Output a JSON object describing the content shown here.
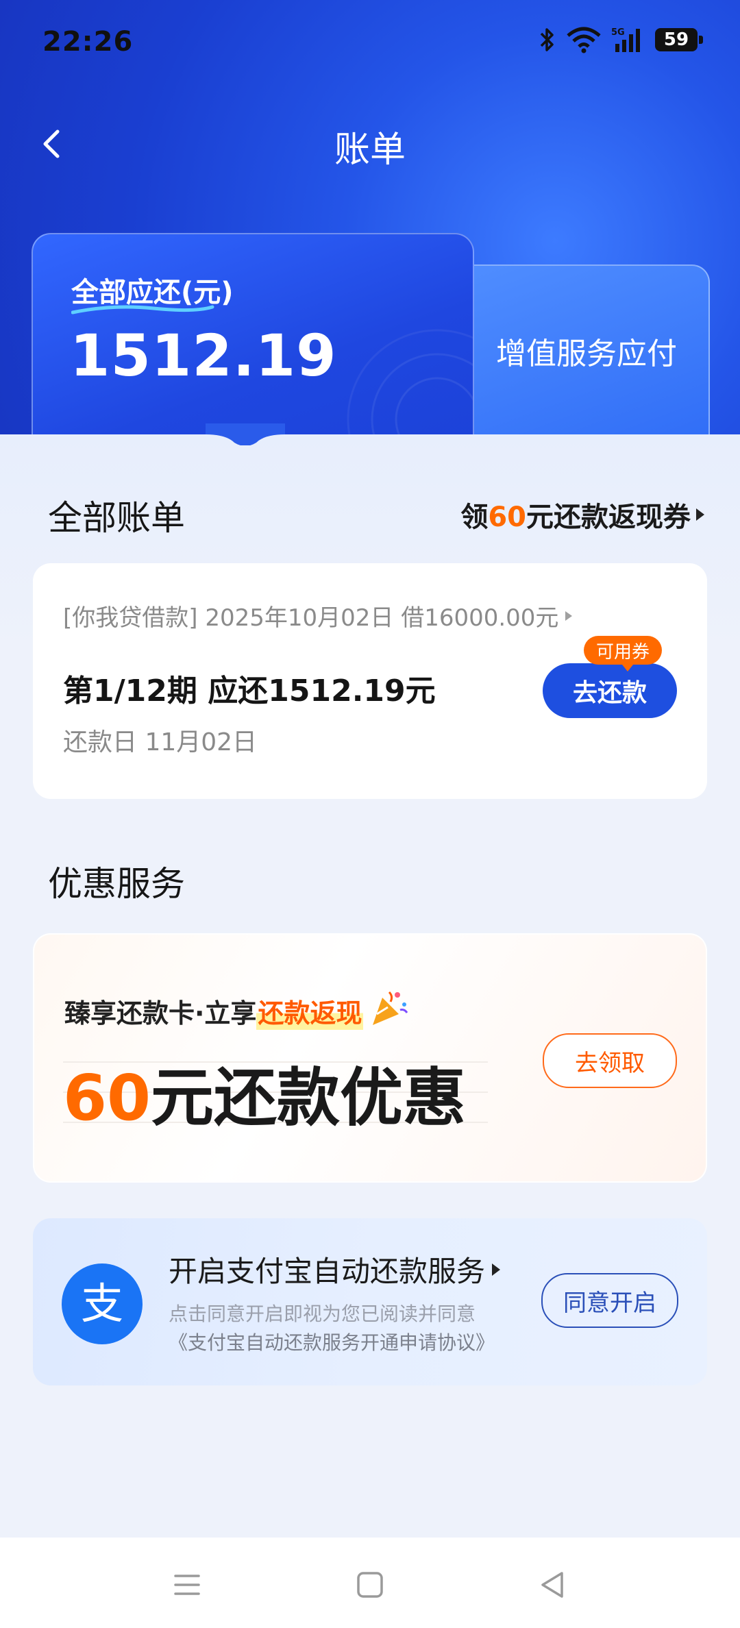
{
  "status_bar": {
    "time": "22:26",
    "battery": "59"
  },
  "nav": {
    "title": "账单"
  },
  "summary": {
    "label": "全部应还(元)",
    "amount": "1512.19",
    "side_tab": "增值服务应付"
  },
  "all_bills": {
    "section_title": "全部账单",
    "promo_prefix": "领",
    "promo_amount": "60",
    "promo_suffix": "元还款返现券"
  },
  "bill": {
    "meta": "[你我贷借款] 2025年10月02日 借16000.00元",
    "period": "第1/12期 应还1512.19元",
    "due": "还款日 11月02日",
    "coupon_tag": "可用券",
    "pay_button": "去还款"
  },
  "offers": {
    "section_title": "优惠服务",
    "subtitle_prefix": "臻享还款卡·立享",
    "subtitle_highlight": "还款返现",
    "big_amount": "60",
    "big_suffix": "元还款优惠",
    "claim_button": "去领取"
  },
  "alipay": {
    "logo_char": "支",
    "title": "开启支付宝自动还款服务",
    "note1": "点击同意开启即视为您已阅读并同意",
    "note2": "《支付宝自动还款服务开通申请协议》",
    "agree_button": "同意开启"
  },
  "colors": {
    "brand_blue": "#1e4fe0",
    "accent_orange": "#ff6a00"
  }
}
